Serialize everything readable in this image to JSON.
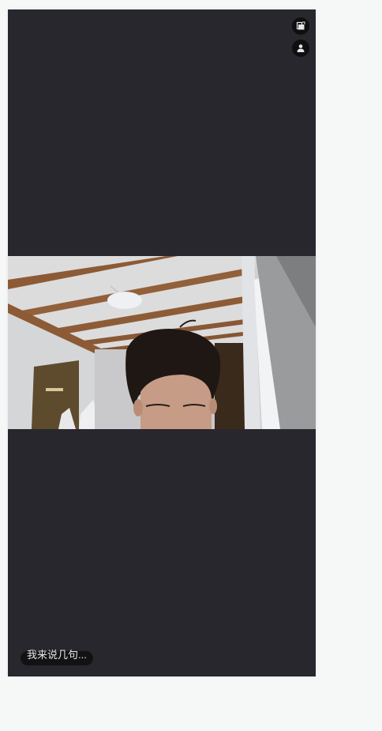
{
  "topIcons": [
    {
      "name": "screen-switch-icon"
    },
    {
      "name": "user-profile-icon"
    }
  ],
  "video": {
    "content": "live-camera-feed"
  },
  "comment": {
    "placeholder": "我来说几句..."
  },
  "colors": {
    "pageBackground": "#f6f7f7",
    "stageBackground": "#28272d",
    "iconBackground": "#0f0f12",
    "pillBackground": "#121214",
    "pillText": "#e8e8ea"
  }
}
